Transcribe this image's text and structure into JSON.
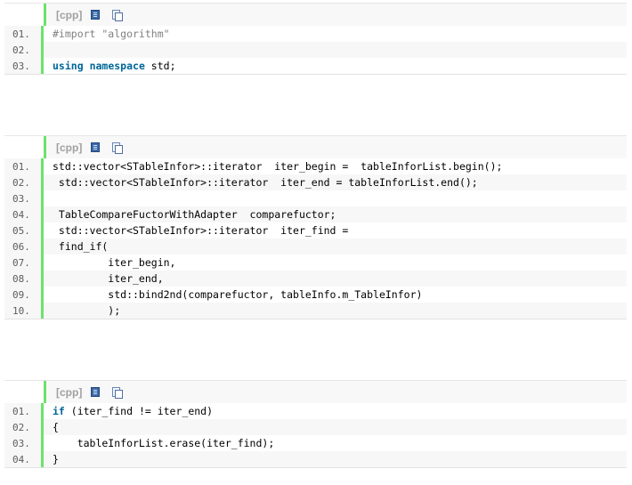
{
  "blocks": [
    {
      "lang": "[cpp]",
      "lines": [
        {
          "num": "01.",
          "segs": [
            {
              "t": "#import \"algorithm\"",
              "c": "pre"
            }
          ]
        },
        {
          "num": "02.",
          "segs": []
        },
        {
          "num": "03.",
          "segs": [
            {
              "t": "using",
              "c": "kw"
            },
            {
              "t": " "
            },
            {
              "t": "namespace",
              "c": "kw"
            },
            {
              "t": " std;"
            }
          ]
        }
      ]
    },
    {
      "lang": "[cpp]",
      "lines": [
        {
          "num": "01.",
          "segs": [
            {
              "t": "std::vector<STableInfor>::iterator  iter_begin =  tableInforList.begin();"
            }
          ]
        },
        {
          "num": "02.",
          "segs": [
            {
              "t": " std::vector<STableInfor>::iterator  iter_end = tableInforList.end();"
            }
          ]
        },
        {
          "num": "03.",
          "segs": []
        },
        {
          "num": "04.",
          "segs": [
            {
              "t": " TableCompareFuctorWithAdapter  comparefuctor;"
            }
          ]
        },
        {
          "num": "05.",
          "segs": [
            {
              "t": " std::vector<STableInfor>::iterator  iter_find ="
            }
          ]
        },
        {
          "num": "06.",
          "segs": [
            {
              "t": " find_if("
            }
          ]
        },
        {
          "num": "07.",
          "segs": [
            {
              "t": "         iter_begin,"
            }
          ]
        },
        {
          "num": "08.",
          "segs": [
            {
              "t": "         iter_end,"
            }
          ]
        },
        {
          "num": "09.",
          "segs": [
            {
              "t": "         std::bind2nd(comparefuctor, tableInfo.m_TableInfor)"
            }
          ]
        },
        {
          "num": "10.",
          "segs": [
            {
              "t": "         );"
            }
          ]
        }
      ]
    },
    {
      "lang": "[cpp]",
      "lines": [
        {
          "num": "01.",
          "segs": [
            {
              "t": "if",
              "c": "kw"
            },
            {
              "t": " (iter_find != iter_end)"
            }
          ]
        },
        {
          "num": "02.",
          "segs": [
            {
              "t": "{"
            }
          ]
        },
        {
          "num": "03.",
          "segs": [
            {
              "t": "    tableInforList.erase(iter_find);"
            }
          ]
        },
        {
          "num": "04.",
          "segs": [
            {
              "t": "}"
            }
          ]
        }
      ]
    }
  ],
  "icons": {
    "view_source": "view-source-icon",
    "copy": "copy-icon"
  },
  "colors": {
    "gutter_border": "#6ce26c",
    "keyword": "#006699",
    "preprocessor": "#808080",
    "line_number": "#5c5c5c",
    "toolbar_label": "#a0a0a0"
  }
}
